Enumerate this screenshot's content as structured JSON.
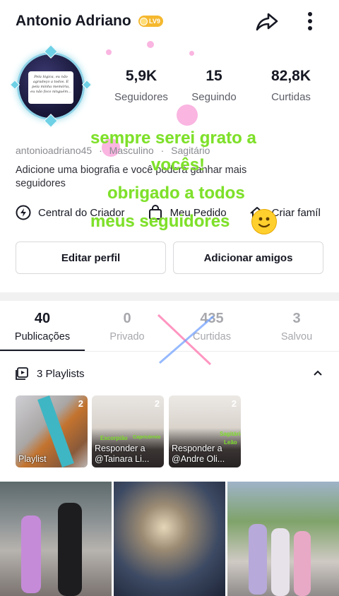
{
  "header": {
    "name": "Antonio Adriano",
    "level_badge": "LV9"
  },
  "avatar": {
    "card_text": "Pela lógica, eu não agradeço a todos. E pela minha memória, eu não foco ninguém..."
  },
  "stats": [
    {
      "value": "5,9K",
      "label": "Seguidores"
    },
    {
      "value": "15",
      "label": "Seguindo"
    },
    {
      "value": "82,8K",
      "label": "Curtidas"
    }
  ],
  "meta": {
    "username": "antonioadriano45",
    "gender": "Masculino",
    "sign": "Sagitário"
  },
  "bio": "Adicione uma biografia e você poderá ganhar mais seguidores",
  "links": [
    {
      "label": "Central do Criador",
      "icon": "bolt-icon"
    },
    {
      "label": "Meu Pedido",
      "icon": "bag-icon"
    },
    {
      "label": "Criar famíl",
      "icon": "family-icon"
    }
  ],
  "buttons": {
    "edit": "Editar perfil",
    "add": "Adicionar amigos"
  },
  "tabs": [
    {
      "value": "40",
      "label": "Publicações"
    },
    {
      "value": "0",
      "label": "Privado"
    },
    {
      "value": "435",
      "label": "Curtidas"
    },
    {
      "value": "3",
      "label": "Salvou"
    }
  ],
  "playlists": {
    "header": "3 Playlists",
    "items": [
      {
        "title": "Playlist",
        "count": "2"
      },
      {
        "title": "Responder a @Tainara Li...",
        "count": "2",
        "tag1": "Escorpião",
        "tag2": "Capricórnio"
      },
      {
        "title": "Responder a @Andre Oli...",
        "count": "2",
        "tag1": "Sagitário",
        "tag2": "Leão"
      }
    ]
  },
  "overlay": {
    "line1": "sempre serei grato a",
    "line2": "vocês!",
    "line3": "obrigado a todos",
    "line4": "meus seguidores"
  },
  "colors": {
    "overlay_green": "#7ee02a",
    "badge_gold": "#f5b82e"
  }
}
